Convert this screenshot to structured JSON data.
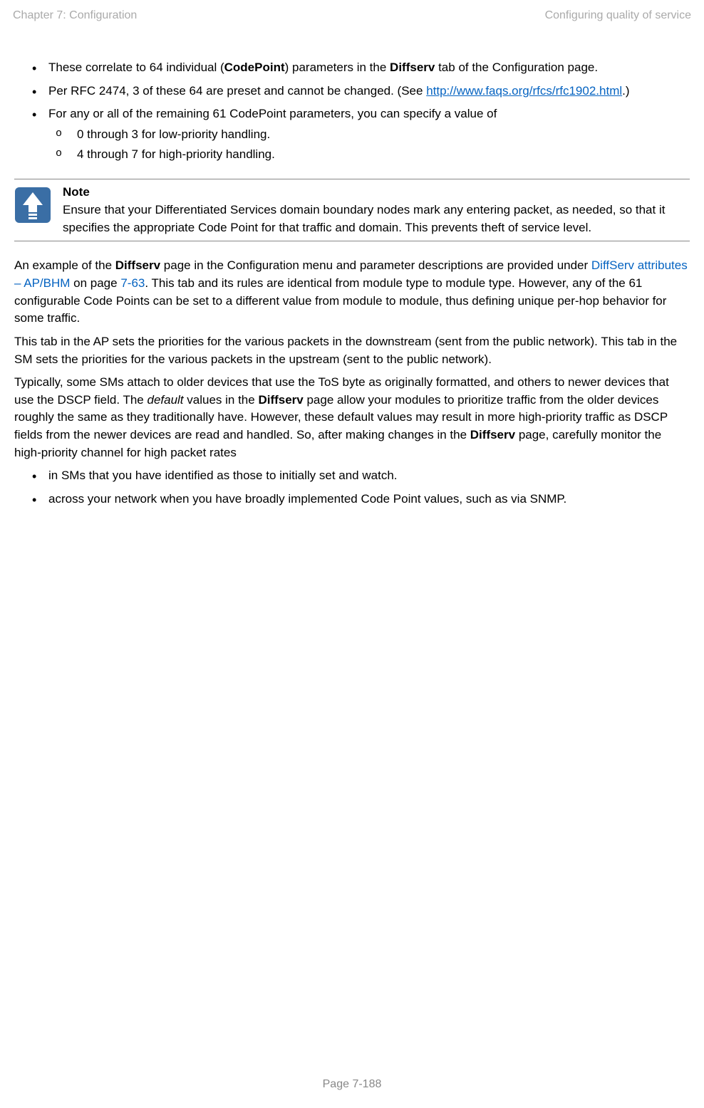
{
  "header": {
    "left": "Chapter 7:  Configuration",
    "right": "Configuring quality of service"
  },
  "list1": {
    "item1_pre": "These correlate to 64 individual (",
    "item1_bold1": "CodePoint",
    "item1_mid": ") parameters in the ",
    "item1_bold2": "Diffserv",
    "item1_post": " tab of the Configuration page.",
    "item2_pre": "Per RFC 2474, 3 of these 64 are preset and cannot be changed. (See ",
    "item2_link": "http://www.faqs.org/rfcs/rfc1902.html",
    "item2_post": ".)",
    "item3": "For any or all of the remaining 61 CodePoint parameters, you can specify a value of",
    "item3_sub1": "0 through 3 for low-priority handling.",
    "item3_sub2": "4 through 7 for high-priority handling."
  },
  "note": {
    "title": "Note",
    "body": "Ensure that your Differentiated Services domain boundary nodes mark any entering packet, as needed, so that it specifies the appropriate Code Point for that traffic and domain. This prevents theft of service level."
  },
  "para1": {
    "pre": "An example of the ",
    "bold": "Diffserv",
    "mid": " page in the Configuration menu and parameter descriptions are provided under ",
    "xref_text": "DiffServ attributes – AP/BHM",
    "mid2": " on page ",
    "xref_page": "7-63",
    "post": ". This tab and its rules are identical from module type to module type. However, any of the 61 configurable Code Points can be set to a different value from module to module, thus defining unique per-hop behavior for some traffic."
  },
  "para2": "This tab in the AP sets the priorities for the various packets in the downstream (sent from the public network). This tab in the SM sets the priorities for the various packets in the upstream (sent to the public network).",
  "para3": {
    "pre": "Typically, some SMs attach to older devices that use the ToS byte as originally formatted, and others to newer devices that use the DSCP field. The ",
    "italic": "default",
    "mid": " values in the ",
    "bold1": "Diffserv",
    "mid2": " page allow your modules to prioritize traffic from the older devices roughly the same as they traditionally have. However, these default values may result in more high-priority traffic as DSCP fields from the newer devices are read and handled. So, after making changes in the ",
    "bold2": "Diffserv",
    "post": " page, carefully monitor the high-priority channel for high packet rates"
  },
  "list2": {
    "item1": "in SMs that you have identified as those to initially set and watch.",
    "item2": "across your network when you have broadly implemented Code Point values, such as via SNMP."
  },
  "footer": "Page 7-188"
}
